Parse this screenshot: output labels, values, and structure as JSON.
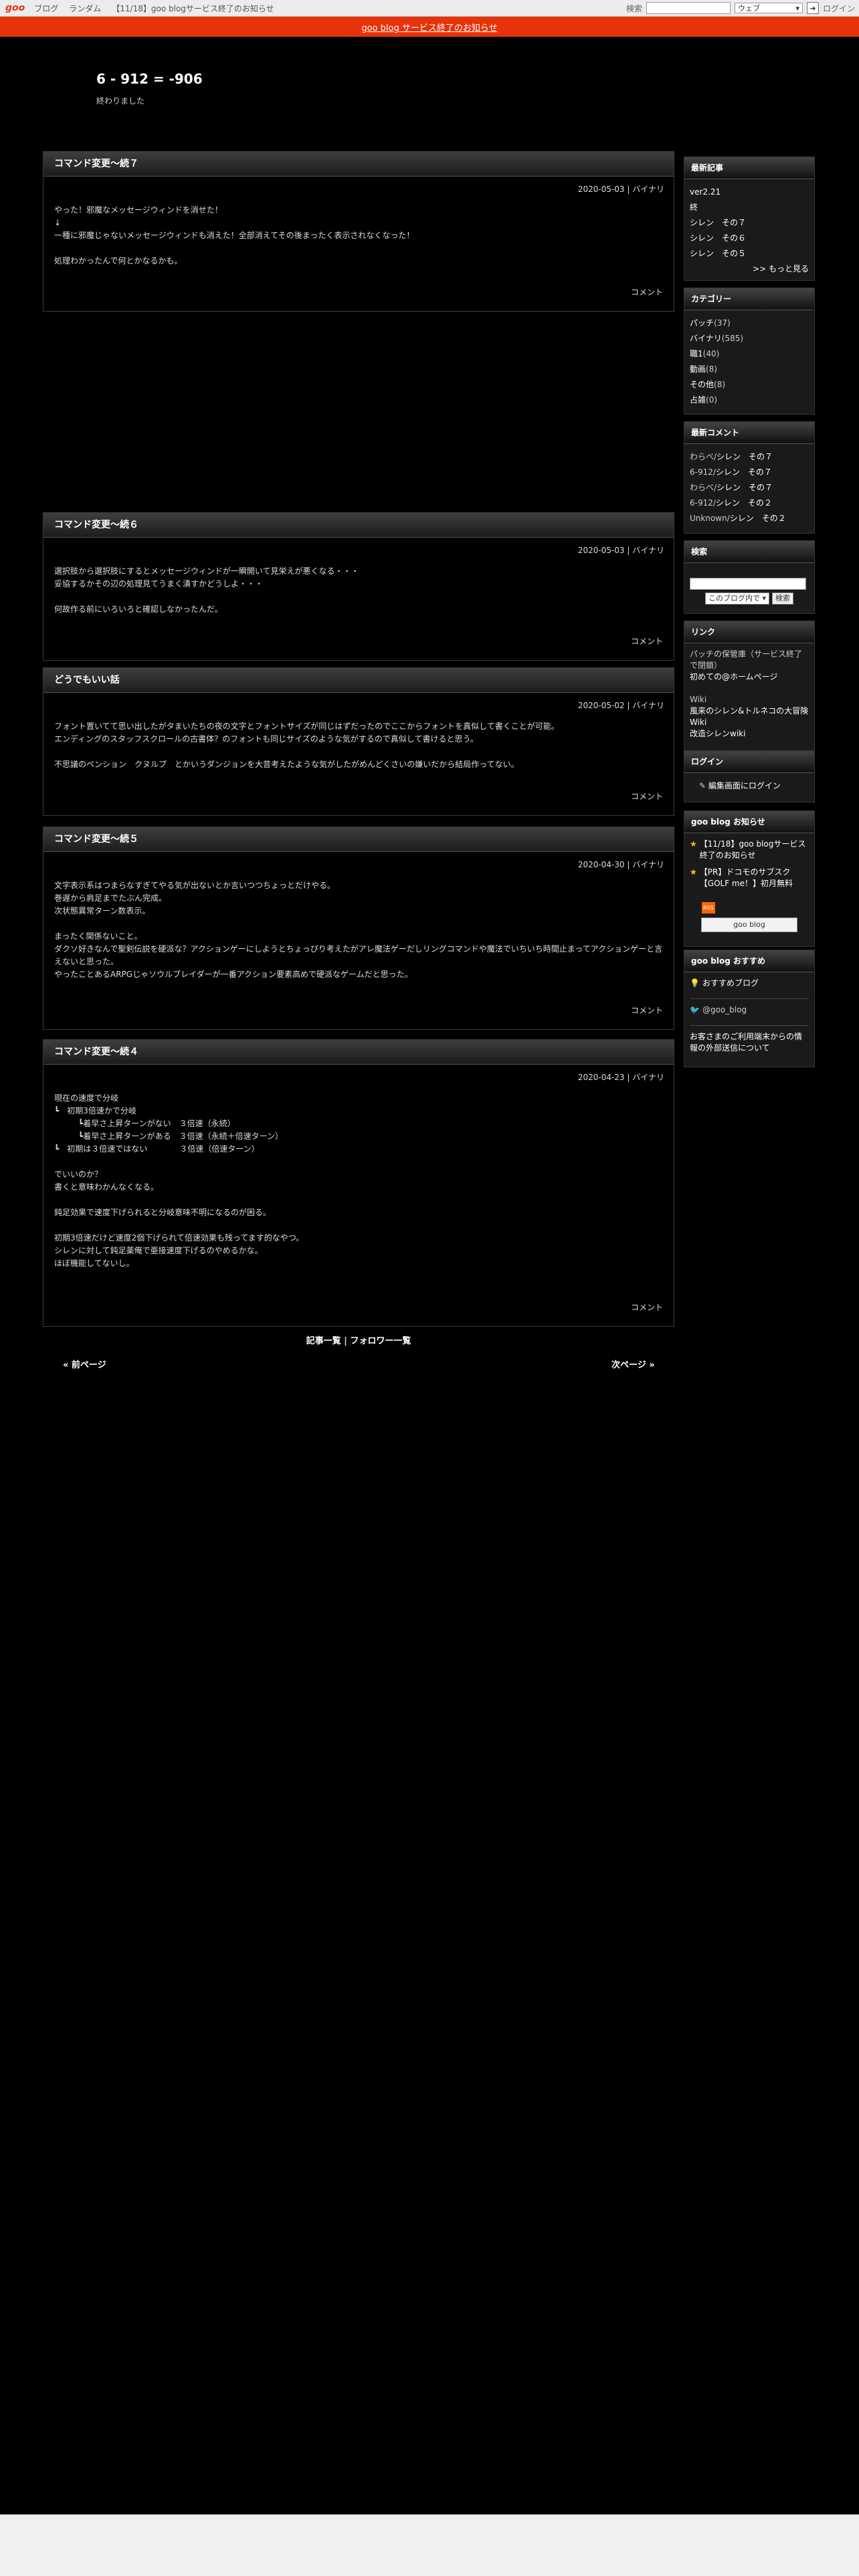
{
  "topbar": {
    "logo": "goo",
    "links": [
      "ブログ",
      "ランダム",
      "【11/18】goo blogサービス終了のお知らせ"
    ],
    "search_label": "検索",
    "search_scope": "ウェブ",
    "login": "ログイン"
  },
  "notice": "goo blog サービス終了のお知らせ",
  "blog": {
    "title": "6 - 912 = -906",
    "description": "終わりました"
  },
  "entries": [
    {
      "title": "コマンド変更〜続７",
      "meta": "2020-05-03 | バイナリ",
      "body": "やった！邪魔なメッセージウィンドを消せた！\n↓\n一種に邪魔じゃないメッセージウィンドも消えた！全部消えてその後まったく表示されなくなった！\n\n処理わかったんで何とかなるかも。",
      "comment": "コメント"
    },
    {
      "title": "コマンド変更〜続６",
      "meta": "2020-05-03 | バイナリ",
      "body": "選択肢から選択肢にするとメッセージウィンドが一瞬開いて見栄えが悪くなる・・・\n妥協するかその辺の処理見てうまく潰すかどうしよ・・・\n\n何故作る前にいろいろと確認しなかったんだ。",
      "comment": "コメント"
    },
    {
      "title": "どうでもいい話",
      "meta": "2020-05-02 | バイナリ",
      "body": "フォント置いてて思い出したがタまいたちの夜の文字とフォントサイズが同じはずだったのでここからフォントを真似して書くことが可能。\nエンディングのスタッフスクロールの古書体？のフォントも同じサイズのような気がするので真似して書けると思う。\n\n不思議のペンション　クヌルプ　とかいうダンジョンを大昔考えたような気がしたがめんどくさいの嫌いだから結局作ってない。",
      "comment": "コメント"
    },
    {
      "title": "コマンド変更〜続５",
      "meta": "2020-04-30 | バイナリ",
      "body": "文字表示系はつまらなすぎてやる気が出ないとか言いつつちょっとだけやる。\n巻遅から肩足までたぶん完成。\n次状態異常ターン数表示。\n\nまったく関係ないこと。\nダクソ好きなんで聖剣伝説を硬派な？アクションゲーにしようとちょっぴり考えたがアレ魔法ゲーだしリングコマンドや魔法でいちいち時間止まってアクションゲーと言えないと思った。\nやったことあるARPGじゃソウルブレイダーが一番アクション要素高めで硬派なゲームだと思った。",
      "comment": "コメント"
    },
    {
      "title": "コマンド変更〜続４",
      "meta": "2020-04-23 | バイナリ",
      "body": "現在の速度で分岐\n┗　初期3倍速かで分岐\n　　　┗着早さ上昇ターンがない　３倍速（永続）\n　　　┗着早さ上昇ターンがある　３倍速（永続＋倍速ターン）\n┗　初期は３倍速ではない　　　　３倍速（倍速ターン）\n\nでいいのか？\n書くと意味わかんなくなる。\n\n鈍足効果で速度下げられると分岐意味不明になるのが困る。\n\n初期3倍速だけど速度2個下げられて倍速効果も残ってます的なやつ。\nシレンに対して鈍足薬俺で亜接速度下げるのやめるかな。\nほぼ機能してないし。",
      "comment": "コメント"
    }
  ],
  "footer": {
    "articles": "記事一覧",
    "separator": "|",
    "followers": "フォロワー一覧",
    "prev": "« 前ページ",
    "next": "次ページ »"
  },
  "sidebar": {
    "recent": {
      "title": "最新記事",
      "items": [
        "ver2.21",
        "終",
        "シレン　その７",
        "シレン　その６",
        "シレン　その５"
      ],
      "more": ">> もっと見る"
    },
    "categories": {
      "title": "カテゴリー",
      "items": [
        {
          "name": "パッチ",
          "count": "(37)"
        },
        {
          "name": "バイナリ",
          "count": "(585)"
        },
        {
          "name": "職1",
          "count": "(40)"
        },
        {
          "name": "動画",
          "count": "(8)"
        },
        {
          "name": "その他",
          "count": "(8)"
        },
        {
          "name": "占雑",
          "count": "(0)"
        }
      ]
    },
    "comments": {
      "title": "最新コメント",
      "items": [
        {
          "who": "わらべ/",
          "link": "シレン　その７"
        },
        {
          "who": "6-912/",
          "link": "シレン　その７"
        },
        {
          "who": "わらべ/",
          "link": "シレン　その７"
        },
        {
          "who": "6-912/",
          "link": "シレン　その２"
        },
        {
          "who": "Unknown/",
          "link": "シレン　その２"
        }
      ]
    },
    "search": {
      "title": "検索",
      "scope": "このブログ内で",
      "button": "検索"
    },
    "links": {
      "title": "リンク",
      "text1": "パッチの保管庫（サービス終了で閉鎖）",
      "link1": "初めての@ホームページ",
      "text2": "Wiki",
      "link2": "風来のシレン&トルネコの大冒険 Wiki",
      "link3": "改造シレンwiki"
    },
    "login": {
      "title": "ログイン",
      "link": "編集画面にログイン"
    },
    "news": {
      "title": "goo blog お知らせ",
      "items": [
        "【11/18】goo blogサービス終了のお知らせ",
        "【PR】ドコモのサブスク【GOLF me！】初月無料"
      ],
      "rss": "RSS",
      "badge": "goo blog"
    },
    "recommend": {
      "title": "goo blog おすすめ",
      "item1": "おすすめブログ",
      "item2": "@goo_blog",
      "item3": "お客さまのご利用端末からの情報の外部送信について"
    }
  }
}
